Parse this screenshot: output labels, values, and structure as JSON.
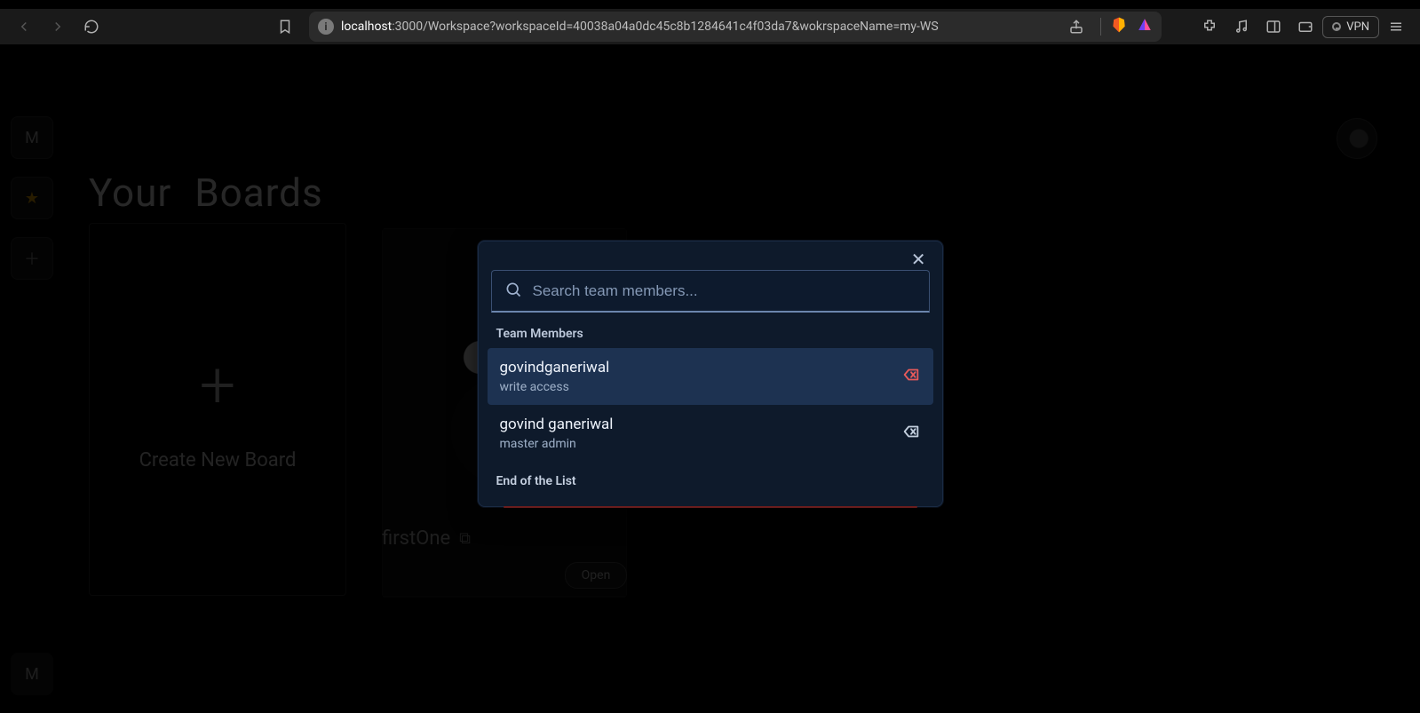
{
  "browser": {
    "url_host": "localhost",
    "url_path": ":3000/Workspace?workspaceId=40038a04a0dc45c8b1284641c4f03da7&wokrspaceName=my-WS",
    "vpn_label": "VPN"
  },
  "sidebar": {
    "top_avatar_letter": "M",
    "bottom_avatar_letter": "M"
  },
  "page": {
    "title_word1": "Your",
    "title_word2": "Boards",
    "create_board_label": "Create New Board",
    "board_name": "firstOne",
    "open_label": "Open"
  },
  "modal": {
    "search_placeholder": "Search team members...",
    "section_label": "Team Members",
    "eol_label": "End of the List",
    "members": [
      {
        "name": "govindganeriwal",
        "role": "write access",
        "active": true,
        "remove_style": "red"
      },
      {
        "name": "govind ganeriwal",
        "role": "master admin",
        "active": false,
        "remove_style": "grey"
      }
    ]
  }
}
